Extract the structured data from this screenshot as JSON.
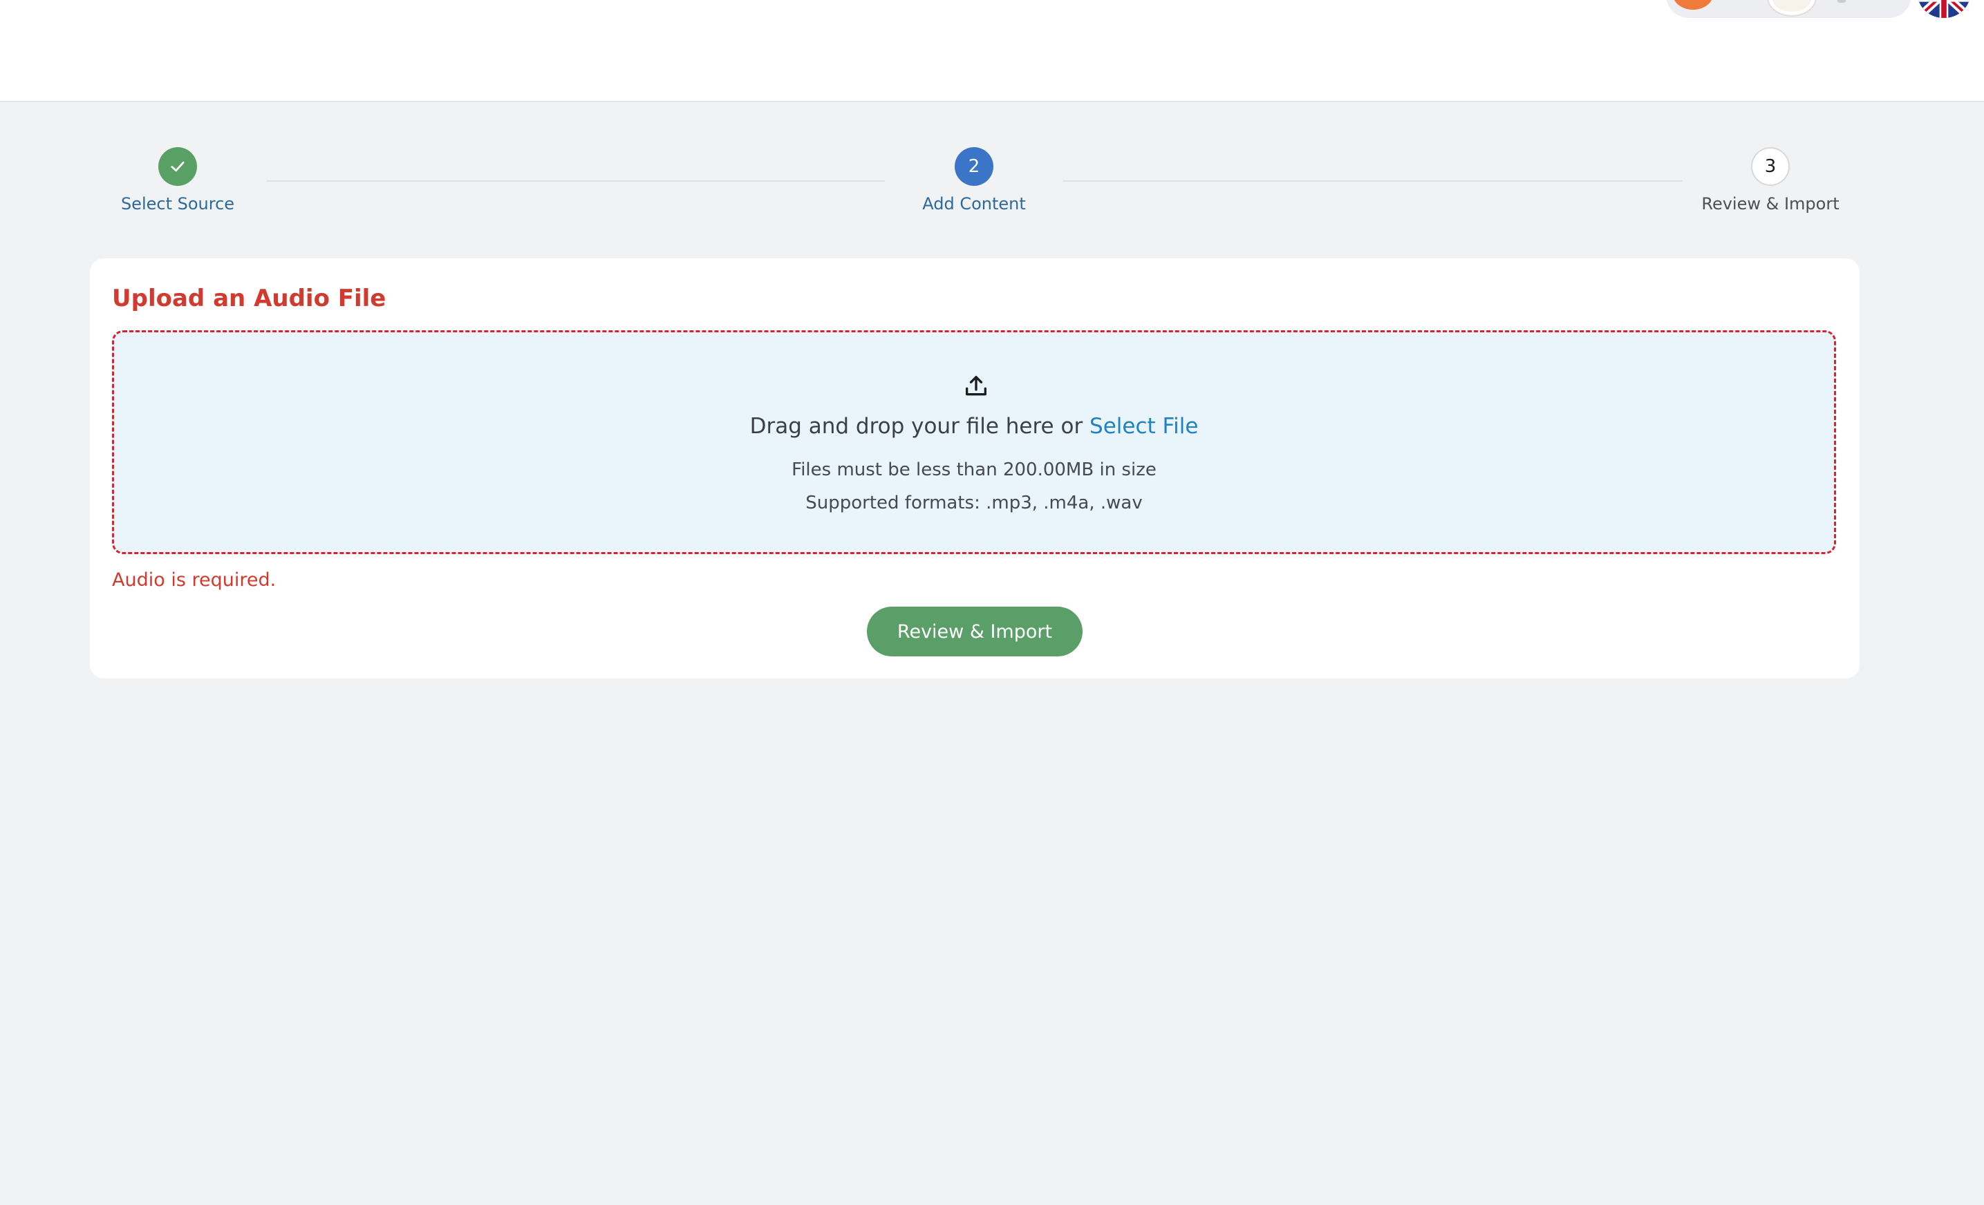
{
  "header": {
    "user_avatar_icon": "user-avatar",
    "secondary_avatar_icon": "profile-avatar",
    "language_flag_icon": "uk-flag-icon"
  },
  "stepper": {
    "steps": [
      {
        "number": "1",
        "label": "Select Source",
        "state": "done"
      },
      {
        "number": "2",
        "label": "Add Content",
        "state": "active"
      },
      {
        "number": "3",
        "label": "Review & Import",
        "state": "pending"
      }
    ]
  },
  "upload": {
    "title": "Upload an Audio File",
    "drag_text": "Drag and drop your file here or",
    "select_link": "Select File",
    "size_limit": "Files must be less than 200.00MB in size",
    "formats": "Supported formats: .mp3, .m4a, .wav",
    "error": "Audio is required.",
    "submit_label": "Review & Import"
  },
  "colors": {
    "success": "#58a064",
    "active": "#3b75c8",
    "error": "#d03a2f",
    "link": "#1e82c4",
    "dropzone_bg": "#eaf4fb"
  }
}
